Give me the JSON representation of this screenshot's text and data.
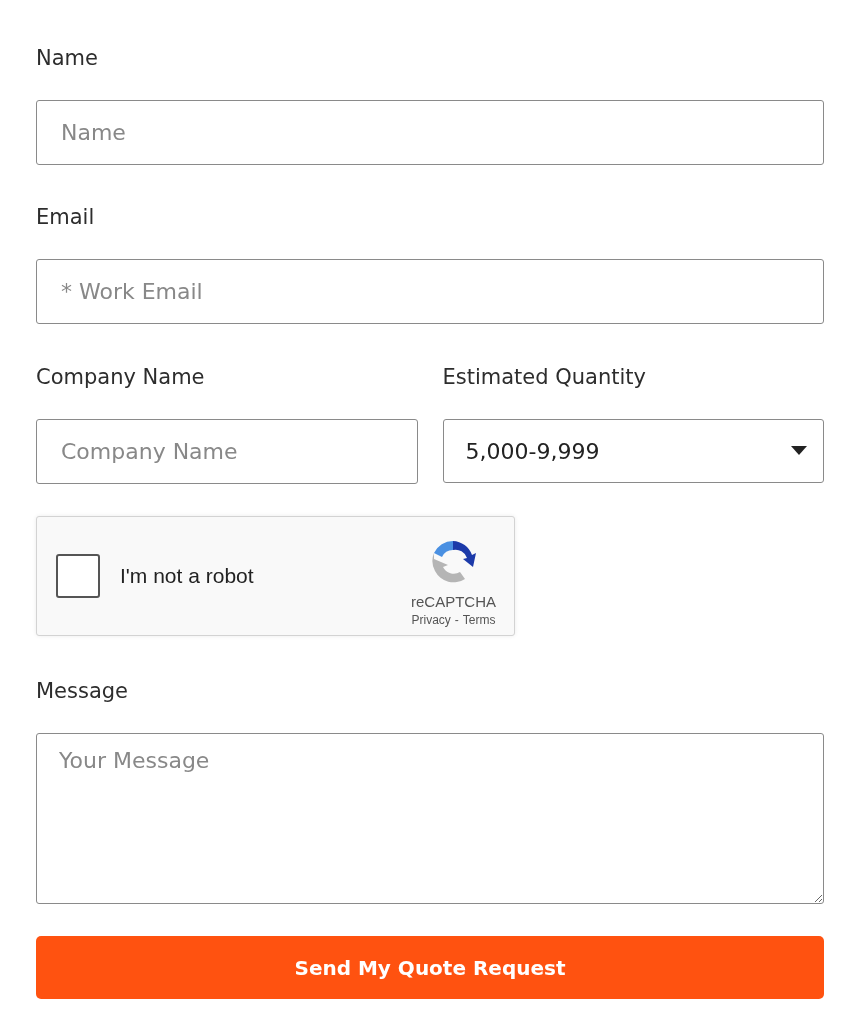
{
  "name": {
    "label": "Name",
    "placeholder": "Name"
  },
  "email": {
    "label": "Email",
    "placeholder": "* Work Email"
  },
  "company": {
    "label": "Company Name",
    "placeholder": "Company Name"
  },
  "quantity": {
    "label": "Estimated Quantity",
    "value": "5,000-9,999"
  },
  "captcha": {
    "label": "I'm not a robot",
    "checked": false,
    "brand": "reCAPTCHA",
    "privacy": "Privacy",
    "separator": "-",
    "terms": "Terms"
  },
  "message": {
    "label": "Message",
    "placeholder": "Your Message"
  },
  "submit": "Send My Quote Request"
}
